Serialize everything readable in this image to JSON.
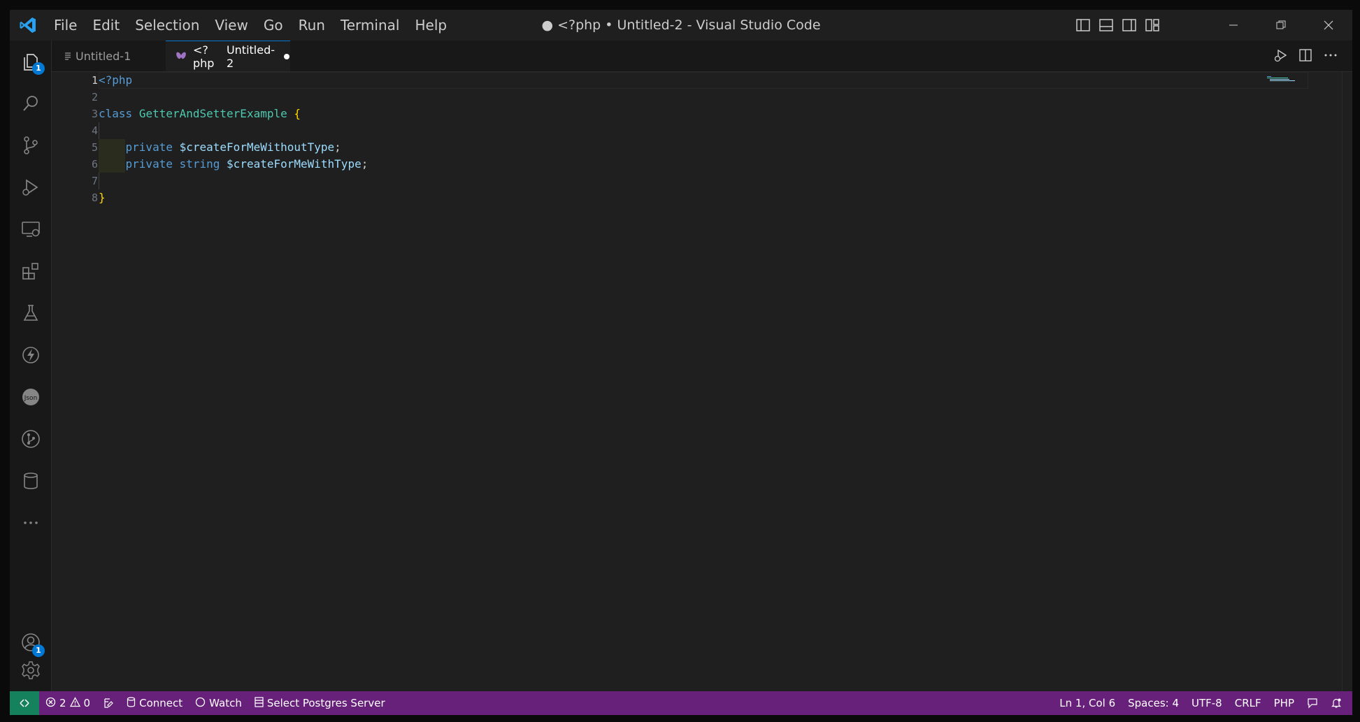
{
  "window": {
    "title": "● <?php • Untitled-2 - Visual Studio Code"
  },
  "menu": [
    "File",
    "Edit",
    "Selection",
    "View",
    "Go",
    "Run",
    "Terminal",
    "Help"
  ],
  "activity": {
    "explorer_badge": "1",
    "accounts_badge": "1",
    "json_label": "Json"
  },
  "tabs": [
    {
      "label": "Untitled-1",
      "active": false
    },
    {
      "prefix": "<?php",
      "label": "Untitled-2",
      "active": true,
      "dirty": true
    }
  ],
  "editor": {
    "line_numbers": [
      "1",
      "2",
      "3",
      "4",
      "5",
      "6",
      "7",
      "8"
    ],
    "lines": {
      "l1_tag": "<?php",
      "l3_kw": "class",
      "l3_name": "GetterAndSetterExample",
      "l3_brace": "{",
      "l5_kw": "private",
      "l5_var": "$createForMeWithoutType",
      "l5_semi": ";",
      "l6_kw": "private",
      "l6_type": "string",
      "l6_var": "$createForMeWithType",
      "l6_semi": ";",
      "l8_brace": "}"
    }
  },
  "statusbar": {
    "errors": "2",
    "warnings": "0",
    "connect": "Connect",
    "watch": "Watch",
    "postgres": "Select Postgres Server",
    "position": "Ln 1, Col 6",
    "spaces": "Spaces: 4",
    "encoding": "UTF-8",
    "eol": "CRLF",
    "language": "PHP"
  },
  "colors": {
    "statusbar": "#68217a",
    "remote": "#16825d",
    "accent": "#0078d4"
  }
}
